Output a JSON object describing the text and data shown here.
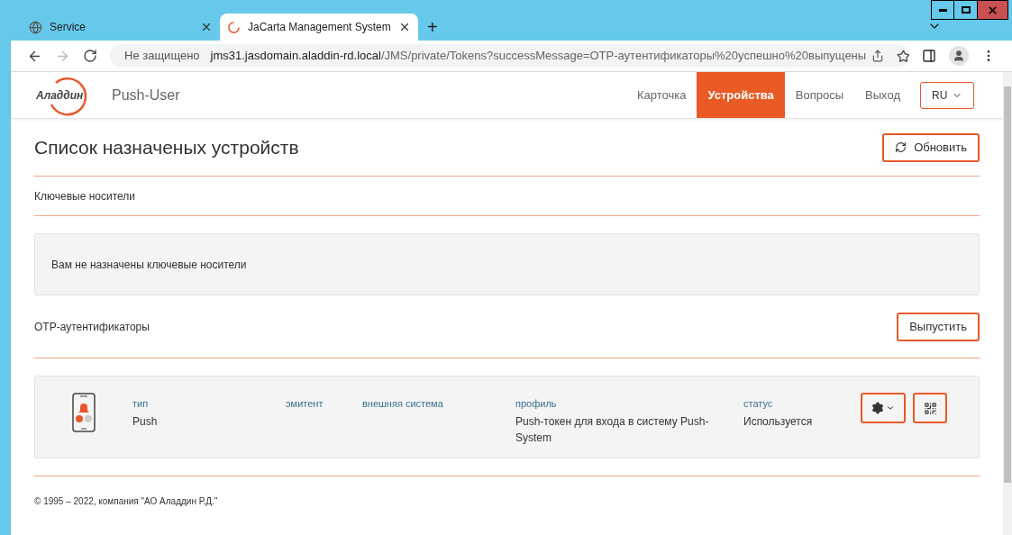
{
  "browser": {
    "tabs": [
      {
        "title": "Service",
        "selected": false
      },
      {
        "title": "JaCarta Management System",
        "selected": true
      }
    ],
    "new_tab": "+",
    "security": "Не защищено",
    "url_host": "jms31.jasdomain.aladdin-rd.local",
    "url_path": "/JMS/private/Tokens?successMessage=OTP-аутентификаторы%20успешно%20выпущены"
  },
  "header": {
    "logo": "Аладдин",
    "app_name": "Push-User",
    "nav": [
      {
        "label": "Карточка",
        "selected": false
      },
      {
        "label": "Устройства",
        "selected": true
      },
      {
        "label": "Вопросы",
        "selected": false
      },
      {
        "label": "Выход",
        "selected": false
      }
    ],
    "language": "RU"
  },
  "page": {
    "title": "Список назначеных устройств",
    "refresh_button": "Обновить",
    "key_carriers": {
      "heading": "Ключевые носители",
      "empty_message": "Вам не назначены ключевые носители"
    },
    "otp": {
      "heading": "OTP-аутентификаторы",
      "issue_button": "Выпустить",
      "devices": [
        {
          "fields": [
            {
              "label": "тип",
              "value": "Push"
            },
            {
              "label": "эмитент"
            },
            {
              "label": "внешняя система"
            },
            {
              "label": "профиль",
              "value": "Push-токен для входа в систему Push-System"
            },
            {
              "label": "статус",
              "value": "Используется"
            }
          ]
        }
      ]
    }
  },
  "footer": "© 1995 – 2022, компания \"АО Аладдин Р.Д.\""
}
